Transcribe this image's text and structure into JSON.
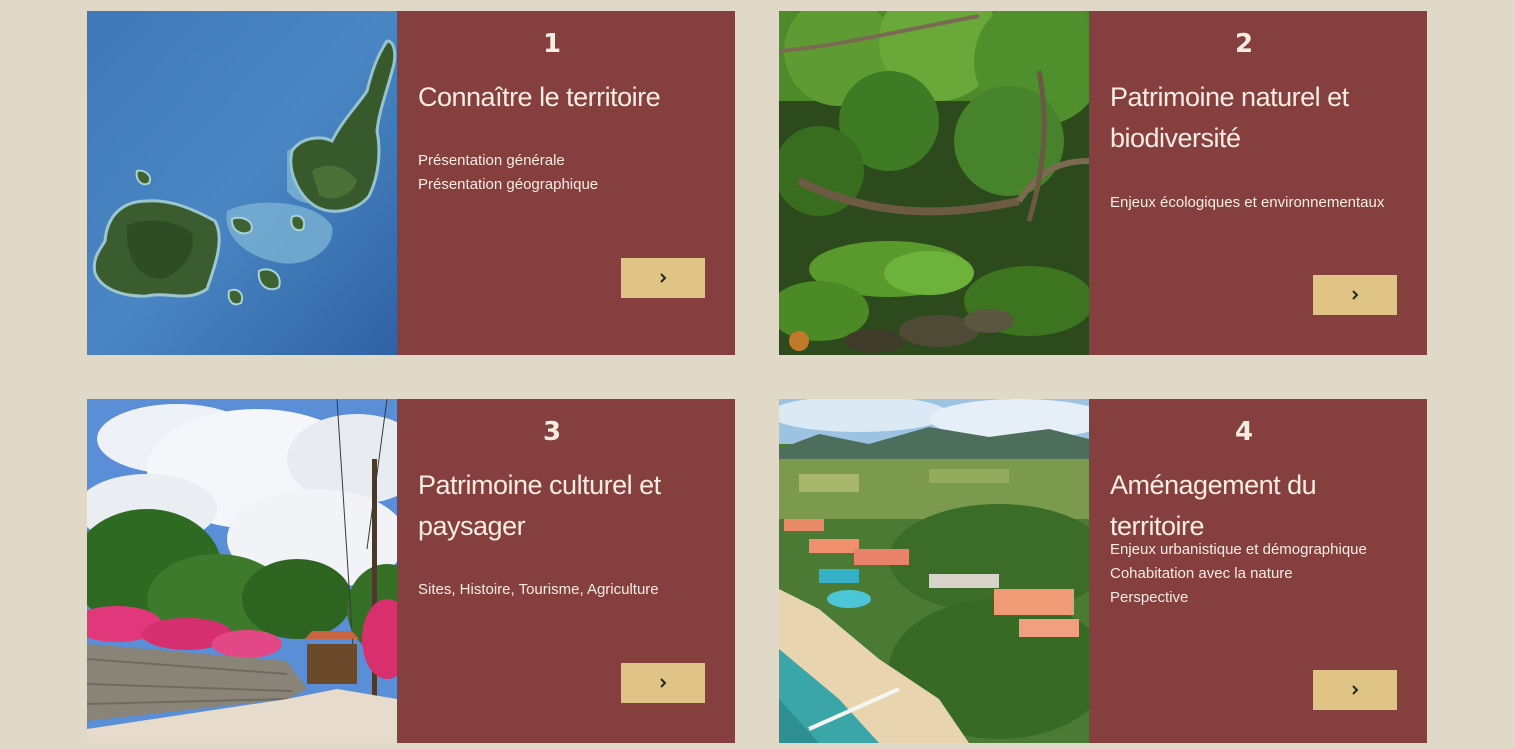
{
  "cards": [
    {
      "number": "1",
      "title": "Connaître le territoire",
      "items": [
        "Présentation générale",
        "Présentation géographique"
      ],
      "image_icon": "satellite-map-image",
      "button_icon": "chevron-right-icon"
    },
    {
      "number": "2",
      "title": "Patrimoine naturel et biodiversité",
      "items": [
        "Enjeux écologiques et environnementaux"
      ],
      "image_icon": "forest-image",
      "button_icon": "chevron-right-icon"
    },
    {
      "number": "3",
      "title": "Patrimoine culturel et paysager",
      "items": [
        "Sites, Histoire, Tourisme, Agriculture"
      ],
      "image_icon": "village-street-image",
      "button_icon": "chevron-right-icon"
    },
    {
      "number": "4",
      "title": "Aménagement du territoire",
      "items": [
        "Enjeux urbanistique et démographique",
        "Cohabitation avec la nature",
        "Perspective"
      ],
      "image_icon": "aerial-resort-image",
      "button_icon": "chevron-right-icon"
    }
  ],
  "colors": {
    "page_background": "#e1d9c8",
    "panel_background": "#843f3e",
    "panel_text": "#f6ece2",
    "button_background": "#dfc485",
    "button_icon": "#1e2b1c"
  }
}
